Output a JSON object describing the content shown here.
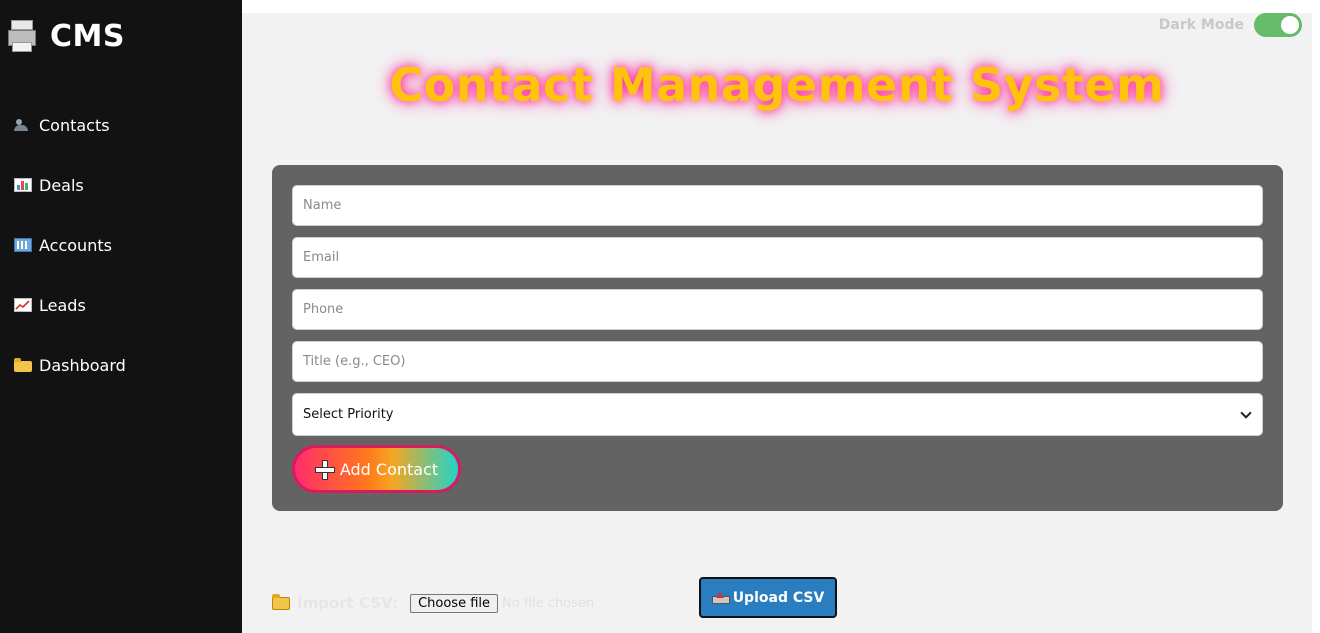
{
  "sidebar": {
    "brand": "CMS",
    "items": [
      {
        "label": "Contacts",
        "icon": "contacts-icon"
      },
      {
        "label": "Deals",
        "icon": "chart-icon"
      },
      {
        "label": "Accounts",
        "icon": "building-icon"
      },
      {
        "label": "Leads",
        "icon": "trending-up-icon"
      },
      {
        "label": "Dashboard",
        "icon": "folder-icon"
      }
    ]
  },
  "header": {
    "dark_mode_label": "Dark Mode",
    "dark_mode_on": true,
    "title": "Contact Management System"
  },
  "form": {
    "name_placeholder": "Name",
    "email_placeholder": "Email",
    "phone_placeholder": "Phone",
    "title_placeholder": "Title (e.g., CEO)",
    "priority_selected": "Select Priority",
    "add_button": "Add Contact"
  },
  "import": {
    "label": "Import CSV:",
    "choose_file": "Choose file",
    "file_status": "No file chosen",
    "upload_button": "Upload CSV"
  },
  "colors": {
    "sidebar_bg": "#121212",
    "title": "#ffc20e",
    "title_glow": "#ff2d95",
    "card_bg": "#636363",
    "toggle_on": "#66bb6a",
    "upload_bg": "#2a7ec0"
  }
}
